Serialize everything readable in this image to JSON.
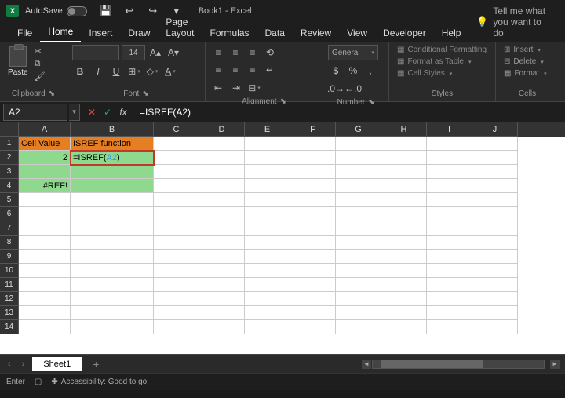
{
  "titlebar": {
    "autosave_label": "AutoSave",
    "book": "Book1",
    "app": "Excel"
  },
  "tabs": [
    "File",
    "Home",
    "Insert",
    "Draw",
    "Page Layout",
    "Formulas",
    "Data",
    "Review",
    "View",
    "Developer",
    "Help"
  ],
  "active_tab": "Home",
  "tellme": "Tell me what you want to do",
  "ribbon": {
    "clipboard": {
      "label": "Clipboard",
      "paste": "Paste"
    },
    "font": {
      "label": "Font",
      "family": "",
      "size": "14"
    },
    "alignment": {
      "label": "Alignment"
    },
    "number": {
      "label": "Number",
      "format": "General"
    },
    "styles": {
      "label": "Styles",
      "cond": "Conditional Formatting",
      "table": "Format as Table",
      "cell": "Cell Styles"
    },
    "cells": {
      "label": "Cells",
      "insert": "Insert",
      "delete": "Delete",
      "format": "Format"
    }
  },
  "namebox": "A2",
  "formula": "=ISREF(A2)",
  "formula_parts": {
    "pre": "=ISREF(",
    "ref": "A2",
    "post": ")"
  },
  "cols": [
    "A",
    "B",
    "C",
    "D",
    "E",
    "F",
    "G",
    "H",
    "I",
    "J"
  ],
  "rows": [
    1,
    2,
    3,
    4,
    5,
    6,
    7,
    8,
    9,
    10,
    11,
    12,
    13,
    14
  ],
  "cells": {
    "A1": "Cell Value",
    "B1": "ISREF function",
    "A2": "2",
    "B2_pre": "=ISREF(",
    "B2_ref": "A2",
    "B2_post": ")",
    "A4": "#REF!"
  },
  "sheet": "Sheet1",
  "status": {
    "mode": "Enter",
    "acc": "Accessibility: Good to go"
  }
}
